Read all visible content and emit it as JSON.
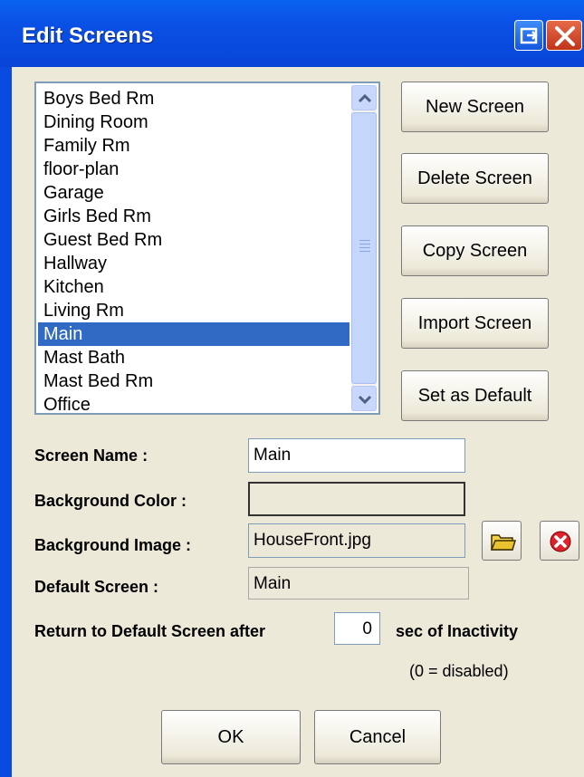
{
  "window": {
    "title": "Edit Screens"
  },
  "titlebar_icons": [
    "restore-icon",
    "close-icon"
  ],
  "screens_list": {
    "items": [
      "Boys Bed Rm",
      "Dining Room",
      "Family Rm",
      "floor-plan",
      "Garage",
      "Girls Bed Rm",
      "Guest Bed Rm",
      "Hallway",
      "Kitchen",
      "Living Rm",
      "Main",
      "Mast Bath",
      "Mast Bed Rm",
      "Office"
    ],
    "selected": "Main"
  },
  "buttons": {
    "new_screen": "New Screen",
    "delete_screen": "Delete Screen",
    "copy_screen": "Copy Screen",
    "import_screen": "Import Screen",
    "set_default": "Set as Default",
    "ok": "OK",
    "cancel": "Cancel"
  },
  "form": {
    "screen_name_label": "Screen Name :",
    "screen_name_value": "Main",
    "bg_color_label": "Background Color :",
    "bg_color_value": "",
    "bg_image_label": "Background Image :",
    "bg_image_value": "HouseFront.jpg",
    "default_screen_label": "Default Screen :",
    "default_screen_value": "Main",
    "return_label": "Return to Default Screen after",
    "return_value": "0",
    "inactivity_label": "sec of Inactivity",
    "disabled_note": "(0 = disabled)"
  },
  "icons": {
    "browse": "folder-icon",
    "clear": "delete-icon"
  },
  "colors": {
    "titlebar": "#0a56e6",
    "selection": "#316ac5",
    "dialog_bg": "#ece9d8",
    "close_button": "#d9472b"
  }
}
